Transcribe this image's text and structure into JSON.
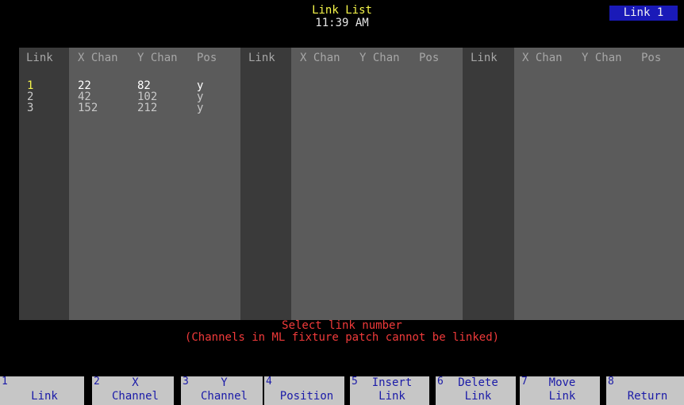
{
  "header": {
    "title": "Link List",
    "clock": "11:39 AM",
    "badge": "Link 1"
  },
  "table": {
    "column_headers": [
      "Link",
      "X Chan",
      "Y Chan",
      "Pos"
    ],
    "rows": [
      {
        "link": "1",
        "x_chan": "22",
        "y_chan": "82",
        "pos": "y"
      },
      {
        "link": "2",
        "x_chan": "42",
        "y_chan": "102",
        "pos": "y"
      },
      {
        "link": "3",
        "x_chan": "152",
        "y_chan": "212",
        "pos": "y"
      }
    ]
  },
  "messages": {
    "prompt": "Select link number",
    "note": "(Channels in ML fixture patch cannot be linked)"
  },
  "softkeys": [
    {
      "num": "1",
      "line1": "",
      "line2": "Link"
    },
    {
      "num": "2",
      "line1": "X",
      "line2": "Channel"
    },
    {
      "num": "3",
      "line1": "Y",
      "line2": "Channel"
    },
    {
      "num": "4",
      "line1": "",
      "line2": "Position"
    },
    {
      "num": "5",
      "line1": "Insert",
      "line2": "Link"
    },
    {
      "num": "6",
      "line1": "Delete",
      "line2": "Link"
    },
    {
      "num": "7",
      "line1": "Move",
      "line2": "Link"
    },
    {
      "num": "8",
      "line1": "",
      "line2": "Return"
    }
  ],
  "colors": {
    "title": "#f7f74a",
    "badge_bg": "#1a1ab8",
    "message": "#f03a3a",
    "softkey_bg": "#c6c6c6",
    "softkey_text": "#1a1aa8",
    "selected_link": "#f5f54a"
  }
}
